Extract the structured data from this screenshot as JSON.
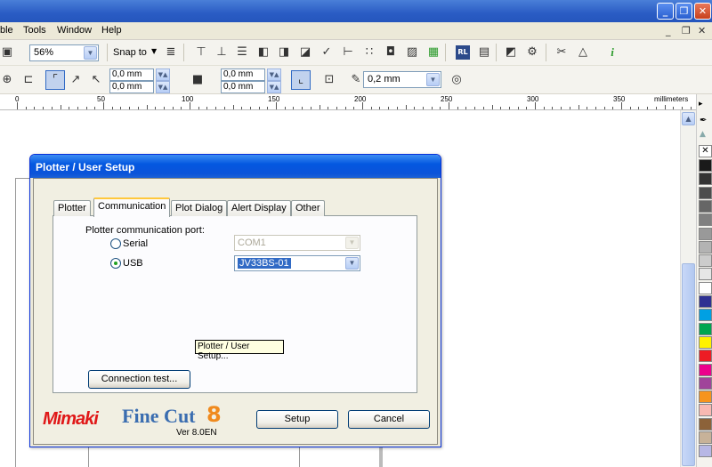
{
  "menu": {
    "items": [
      "ble",
      "Tools",
      "Window",
      "Help"
    ]
  },
  "toolbar": {
    "zoom": "56%",
    "snap_to": "Snap to",
    "pos_x": "0,0 mm",
    "pos_y": "0,0 mm",
    "size_w": "0,0 mm",
    "size_h": "0,0 mm",
    "outline_width": "0,2 mm"
  },
  "ruler": {
    "labels": [
      "0",
      "50",
      "100",
      "150",
      "200",
      "250",
      "300",
      "350"
    ],
    "unit": "millimeters"
  },
  "dialog": {
    "title": "Plotter / User Setup",
    "tabs": [
      "Plotter",
      "Communication",
      "Plot Dialog",
      "Alert Display",
      "Other"
    ],
    "active_tab": "Communication",
    "port_label": "Plotter communication port:",
    "serial_label": "Serial",
    "serial_value": "COM1",
    "usb_label": "USB",
    "usb_value": "JV33BS-01",
    "selected_port": "USB",
    "connection_test": "Connection test...",
    "setup": "Setup",
    "cancel": "Cancel",
    "tooltip": "Plotter / User Setup...",
    "brand_mimaki": "Mimaki",
    "brand_product": "Fine Cut",
    "brand_number": "8",
    "version": "Ver 8.0EN"
  },
  "colors": {
    "titlebar": "#2a5cc4",
    "dialog_title": "#0458e0",
    "mimaki_red": "#e01818",
    "finecut_blue": "#3a6db0",
    "eight_orange": "#f08a1e"
  },
  "palette": [
    "#1a1a1a",
    "#333333",
    "#4d4d4d",
    "#666666",
    "#808080",
    "#999999",
    "#b3b3b3",
    "#cccccc",
    "#e6e6e6",
    "#ffffff",
    "#2e3192",
    "#00a0e3",
    "#00a650",
    "#fff200",
    "#ed1c24",
    "#ec008c",
    "#a0449a",
    "#f7941d",
    "#f9b9b2",
    "#8c6239",
    "#c7b299",
    "#b7b7e5"
  ]
}
